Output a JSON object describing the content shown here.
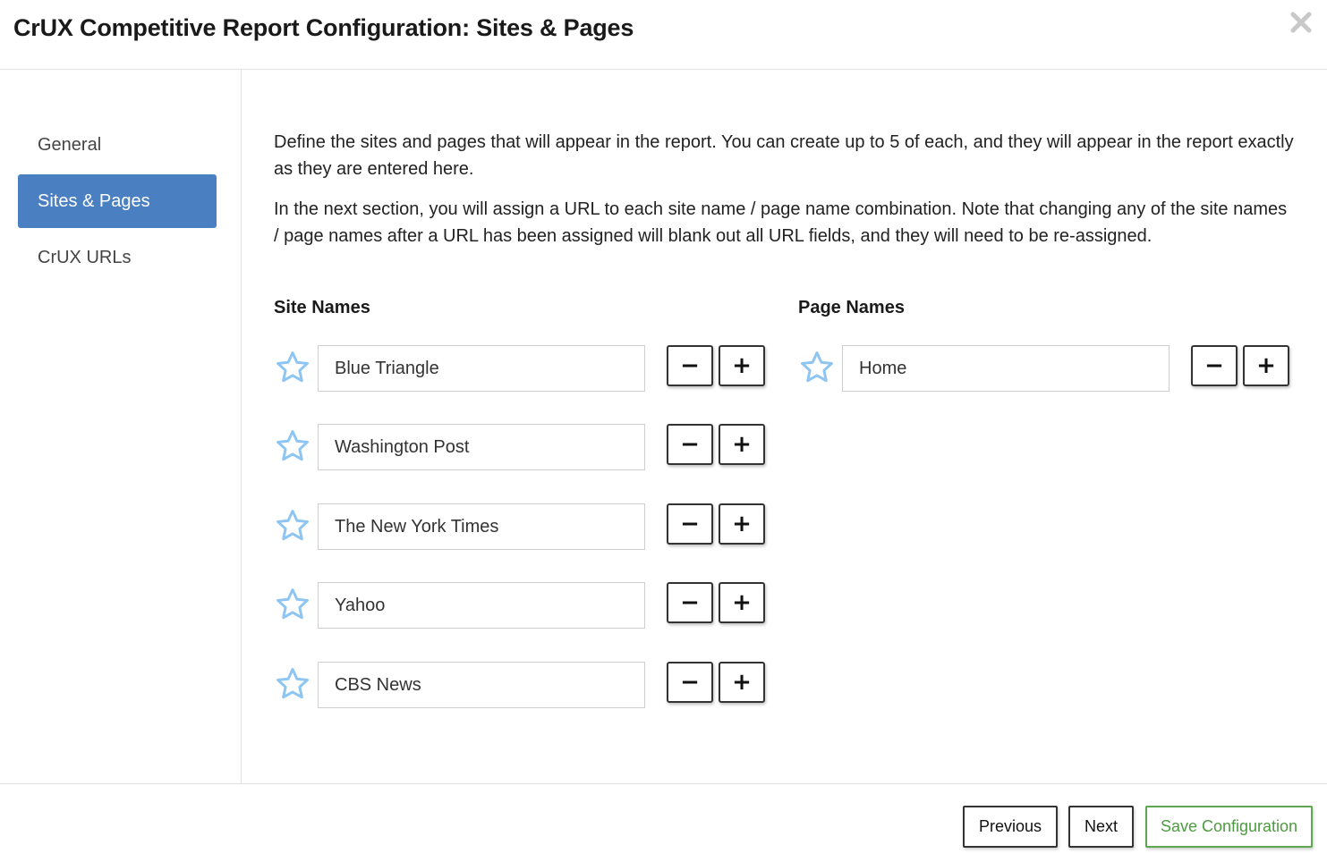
{
  "header": {
    "title": "CrUX Competitive Report Configuration: Sites & Pages",
    "close_icon": "close-icon"
  },
  "sidebar": {
    "items": [
      {
        "label": "General",
        "active": false
      },
      {
        "label": "Sites & Pages",
        "active": true
      },
      {
        "label": "CrUX URLs",
        "active": false
      }
    ],
    "active_color": "#4a7fc1"
  },
  "main": {
    "description_1": "Define the sites and pages that will appear in the report. You can create up to 5 of each, and they will appear in the report exactly as they are entered here.",
    "description_2": "In the next section, you will assign a URL to each site name / page name combination. Note that changing any of the site names / page names after a URL has been assigned will blank out all URL fields, and they will need to be re-assigned.",
    "site_names": {
      "heading": "Site Names",
      "rows": [
        {
          "value": "Blue Triangle",
          "minus": "−",
          "plus": "+"
        },
        {
          "value": "Washington Post",
          "minus": "−",
          "plus": "+"
        },
        {
          "value": "The New York Times",
          "minus": "−",
          "plus": "+"
        },
        {
          "value": "Yahoo",
          "minus": "−",
          "plus": "+"
        },
        {
          "value": "CBS News",
          "minus": "−",
          "plus": "+"
        }
      ]
    },
    "page_names": {
      "heading": "Page Names",
      "rows": [
        {
          "value": "Home",
          "minus": "−",
          "plus": "+"
        }
      ]
    },
    "star_icon": "star-outline-icon",
    "star_color": "#8ec5f2"
  },
  "footer": {
    "previous_label": "Previous",
    "next_label": "Next",
    "save_label": "Save Configuration",
    "save_color": "#5ea64f"
  }
}
